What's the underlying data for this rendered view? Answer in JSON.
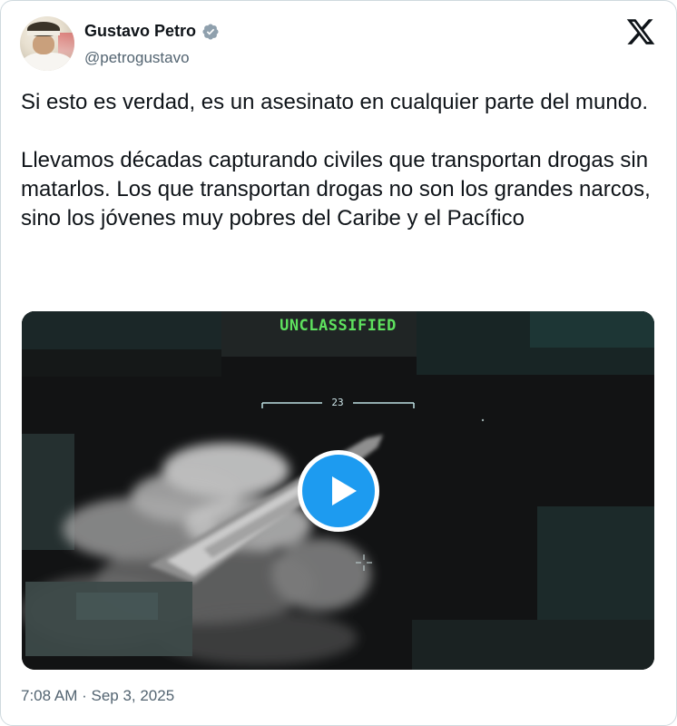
{
  "author": {
    "display_name": "Gustavo Petro",
    "handle": "@petrogustavo",
    "verified": true,
    "verified_badge_color": "#8fa0ad"
  },
  "icons": {
    "avatar": "profile-photo",
    "verified": "verified-badge-icon",
    "brand": "x-logo-icon",
    "play": "play-icon"
  },
  "tweet": {
    "text": "Si esto es verdad, es un asesinato en cualquier parte del mundo.\n\nLlevamos décadas capturando civiles que transportan drogas sin matarlos. Los que transportan drogas no son los grandes narcos, sino los jóvenes muy pobres del Caribe y el Pacífico"
  },
  "media": {
    "type": "video",
    "overlay_label": "UNCLASSIFIED",
    "scale_value": "23",
    "play_button_color": "#1d9bf0",
    "overlay_label_color": "#5ee15e"
  },
  "meta": {
    "timestamp": "7:08 AM · Sep 3, 2025"
  },
  "colors": {
    "text": "#0f1419",
    "secondary_text": "#536471",
    "border": "#cfd9de"
  }
}
